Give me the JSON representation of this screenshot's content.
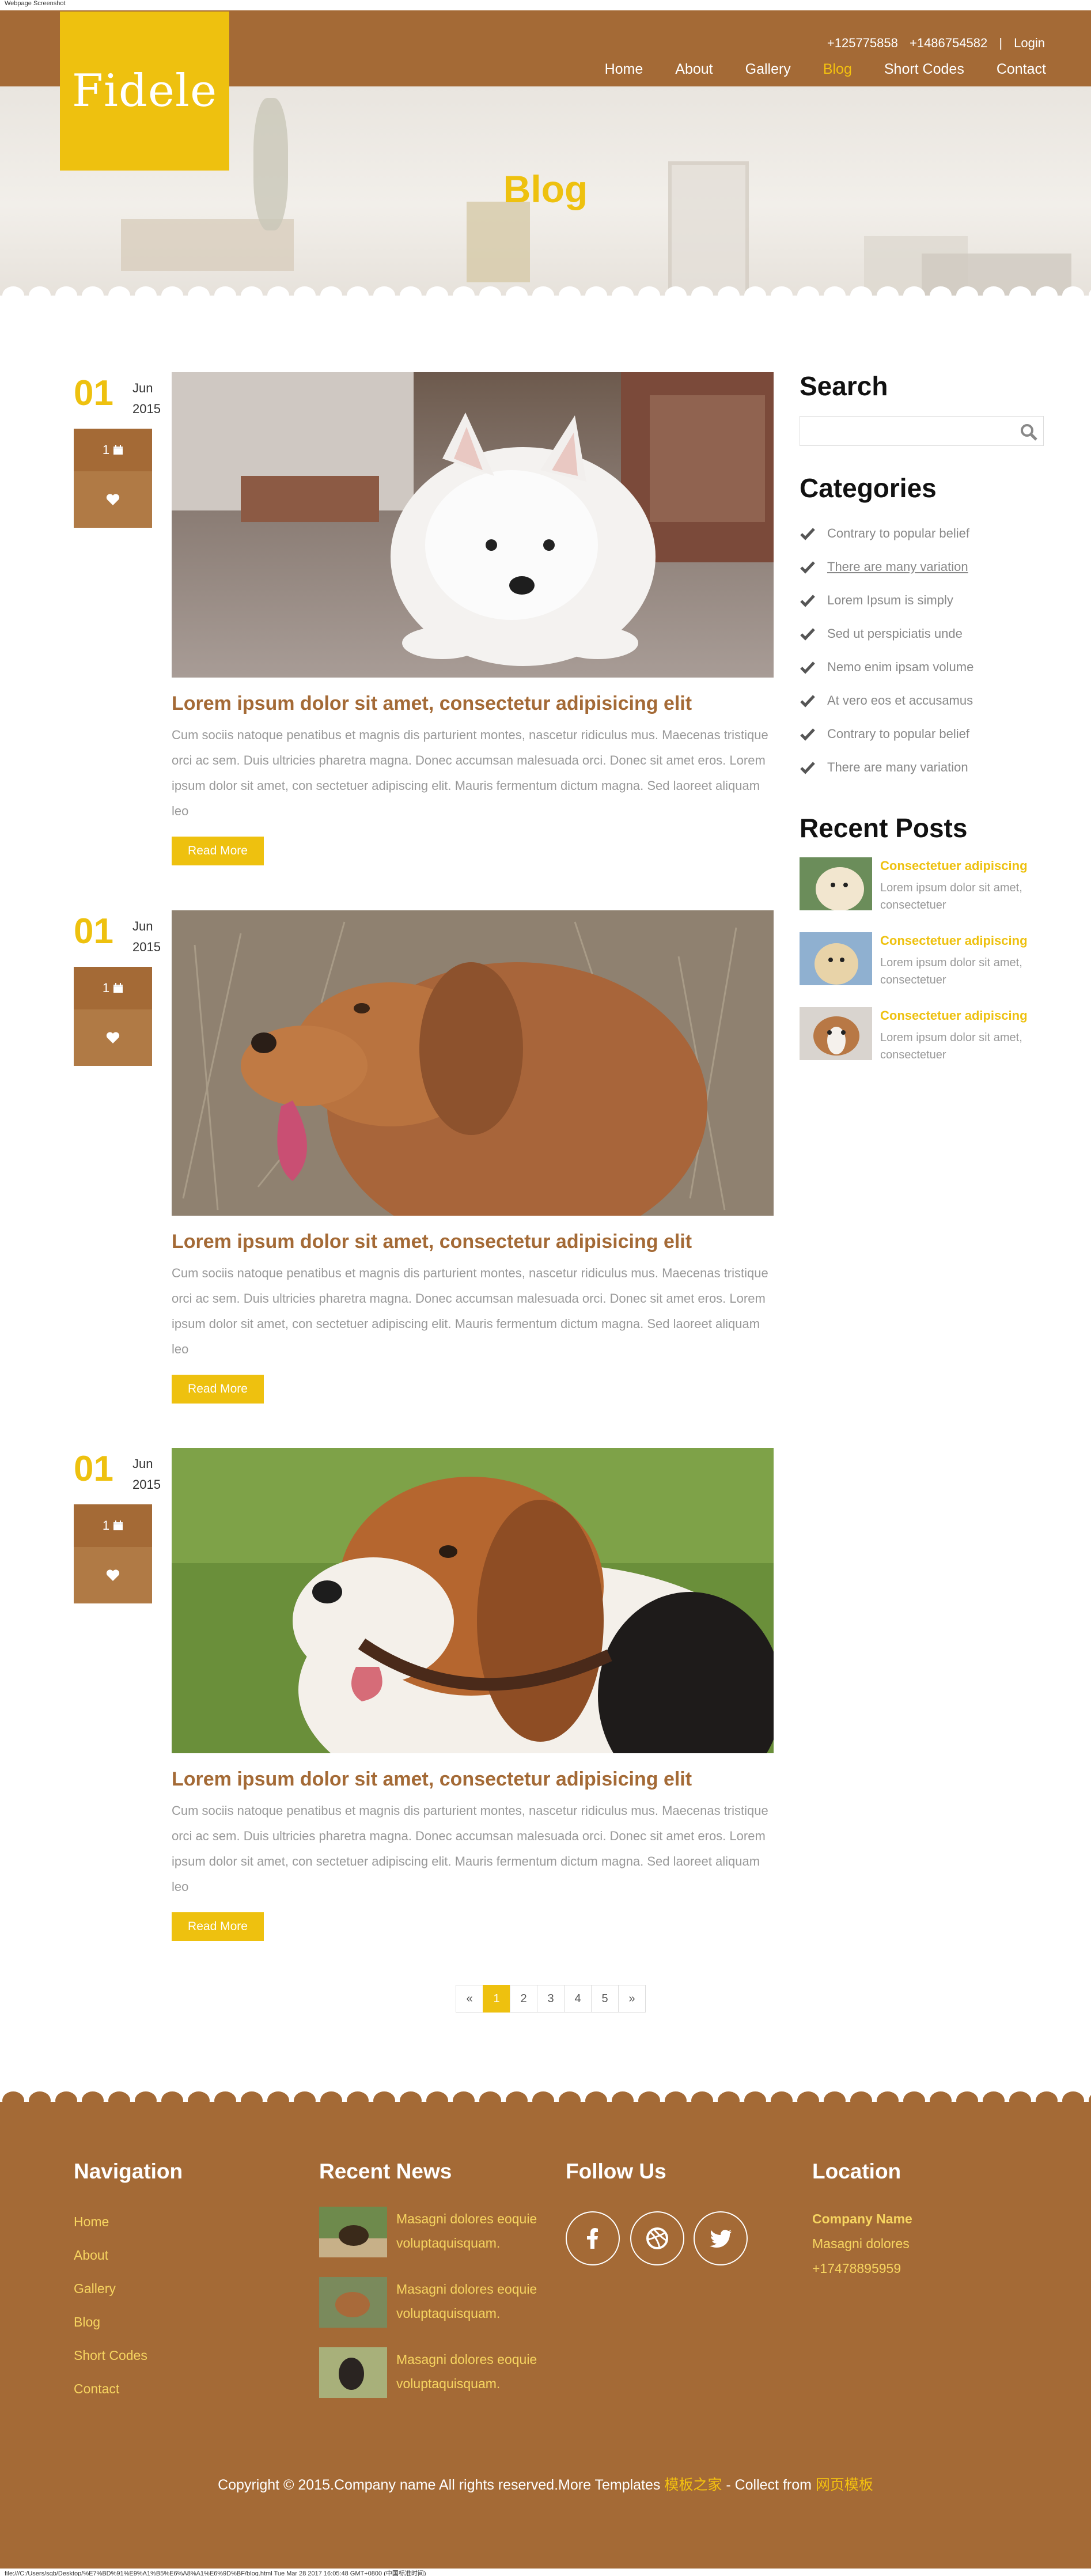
{
  "tab_title": "Webpage Screenshot",
  "brand": {
    "logo": "Fidele",
    "accent": "#eec10f",
    "primary": "#a46a36"
  },
  "header": {
    "phone1": "+125775858",
    "phone2": "+1486754582",
    "separator": "|",
    "login": "Login",
    "nav": [
      "Home",
      "About",
      "Gallery",
      "Blog",
      "Short Codes",
      "Contact"
    ],
    "active_nav": "Blog"
  },
  "hero": {
    "title": "Blog"
  },
  "posts": [
    {
      "day": "01",
      "month": "Jun",
      "year": "2015",
      "comments": "1",
      "title": "Lorem ipsum dolor sit amet, consectetur adipisicing elit",
      "text": "Cum sociis natoque penatibus et magnis dis parturient montes, nascetur ridiculus mus. Maecenas tristique orci ac sem. Duis ultricies pharetra magna. Donec accumsan malesuada orci. Donec sit amet eros. Lorem ipsum dolor sit amet, con sectetuer adipiscing elit. Mauris fermentum dictum magna. Sed laoreet aliquam leo",
      "button": "Read More",
      "image": "white-samoyed-puppy"
    },
    {
      "day": "01",
      "month": "Jun",
      "year": "2015",
      "comments": "1",
      "title": "Lorem ipsum dolor sit amet, consectetur adipisicing elit",
      "text": "Cum sociis natoque penatibus et magnis dis parturient montes, nascetur ridiculus mus. Maecenas tristique orci ac sem. Duis ultricies pharetra magna. Donec accumsan malesuada orci. Donec sit amet eros. Lorem ipsum dolor sit amet, con sectetuer adipiscing elit. Mauris fermentum dictum magna. Sed laoreet aliquam leo",
      "button": "Read More",
      "image": "golden-retriever-in-grass"
    },
    {
      "day": "01",
      "month": "Jun",
      "year": "2015",
      "comments": "1",
      "title": "Lorem ipsum dolor sit amet, consectetur adipisicing elit",
      "text": "Cum sociis natoque penatibus et magnis dis parturient montes, nascetur ridiculus mus. Maecenas tristique orci ac sem. Duis ultricies pharetra magna. Donec accumsan malesuada orci. Donec sit amet eros. Lorem ipsum dolor sit amet, con sectetuer adipiscing elit. Mauris fermentum dictum magna. Sed laoreet aliquam leo",
      "button": "Read More",
      "image": "beagle-on-lawn"
    }
  ],
  "sidebar": {
    "search_title": "Search",
    "search_placeholder": "",
    "categories_title": "Categories",
    "categories": [
      "Contrary to popular belief",
      "There are many variation",
      "Lorem Ipsum is simply",
      "Sed ut perspiciatis unde",
      "Nemo enim ipsam volume",
      "At vero eos et accusamus",
      "Contrary to popular belief",
      "There are many variation"
    ],
    "recent_title": "Recent Posts",
    "recent": [
      {
        "title": "Consectetuer adipiscing",
        "text": "Lorem ipsum dolor sit amet, consectetuer"
      },
      {
        "title": "Consectetuer adipiscing",
        "text": "Lorem ipsum dolor sit amet, consectetuer"
      },
      {
        "title": "Consectetuer adipiscing",
        "text": "Lorem ipsum dolor sit amet, consectetuer"
      }
    ]
  },
  "pagination": {
    "prev": "«",
    "pages": [
      "1",
      "2",
      "3",
      "4",
      "5"
    ],
    "current": "1",
    "next": "»"
  },
  "footer": {
    "nav_title": "Navigation",
    "nav": [
      "Home",
      "About",
      "Gallery",
      "Blog",
      "Short Codes",
      "Contact"
    ],
    "news_title": "Recent News",
    "news": [
      "Masagni dolores eoquie voluptaquisquam.",
      "Masagni dolores eoquie voluptaquisquam.",
      "Masagni dolores eoquie voluptaquisquam."
    ],
    "follow_title": "Follow Us",
    "social": [
      "facebook-icon",
      "dribbble-icon",
      "twitter-icon"
    ],
    "location_title": "Location",
    "company": "Company Name",
    "address": "Masagni dolores",
    "phone": "+17478895959",
    "copyright": "Copyright © 2015.Company name All rights reserved.More Templates",
    "link1": "模板之家",
    "mid": " - Collect from ",
    "link2": "网页模板"
  },
  "statusbar": "file:///C:/Users/sqb/Desktop/%E7%BD%91%E9%A1%B5%E6%A8%A1%E6%9D%BF/blog.html Tue Mar 28 2017 16:05:48 GMT+0800 (中国标准时间)"
}
